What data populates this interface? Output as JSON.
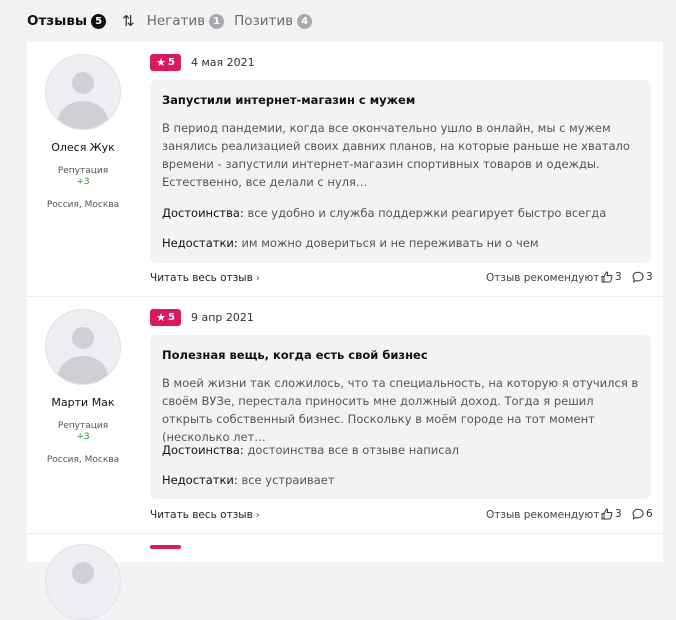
{
  "tabs": [
    {
      "label": "Отзывы",
      "count": "5"
    },
    {
      "label": "Негатив",
      "count": "1"
    },
    {
      "label": "Позитив",
      "count": "4"
    }
  ],
  "sort_icon": "sort-arrows-icon",
  "reviews": [
    {
      "author": "Олеся Жук",
      "reputation_label": "Репутация",
      "reputation_value": "+3",
      "location": "Россия, Москва",
      "rating": "5",
      "date": "4 мая 2021",
      "title": "Запустили интернет-магазин с мужем",
      "text": "В период пандемии, когда все окончательно ушло в онлайн, мы с мужем занялись реализацией своих давних планов, на которые раньше не хватало времени - запустили интернет-магазин спортивных товаров и одежды. Естественно, все делали с нуля…",
      "pros_label": "Достоинства:",
      "pros": "все удобно и служба поддержки реагирует быстро всегда",
      "cons_label": "Недостатки:",
      "cons": "им можно довериться и не переживать ни о чем",
      "read_more": "Читать весь отзыв",
      "recommend": "Отзыв рекомендуют",
      "likes": "3",
      "comments": "3"
    },
    {
      "author": "Марти Мак",
      "reputation_label": "Репутация",
      "reputation_value": "+3",
      "location": "Россия, Москва",
      "rating": "5",
      "date": "9 апр 2021",
      "title": "Полезная вещь, когда есть свой бизнес",
      "text": "В моей жизни так сложилось, что та специальность, на которую я отучился в своём ВУЗе, перестала приносить мне должный доход. Тогда я решил открыть собственный бизнес. Поскольку в моём городе на тот момент (несколько лет…",
      "pros_label": "Достоинства:",
      "pros": "достоинства все в отзыве написал",
      "cons_label": "Недостатки:",
      "cons": "все устраивает",
      "read_more": "Читать весь отзыв",
      "recommend": "Отзыв рекомендуют",
      "likes": "3",
      "comments": "6"
    }
  ]
}
